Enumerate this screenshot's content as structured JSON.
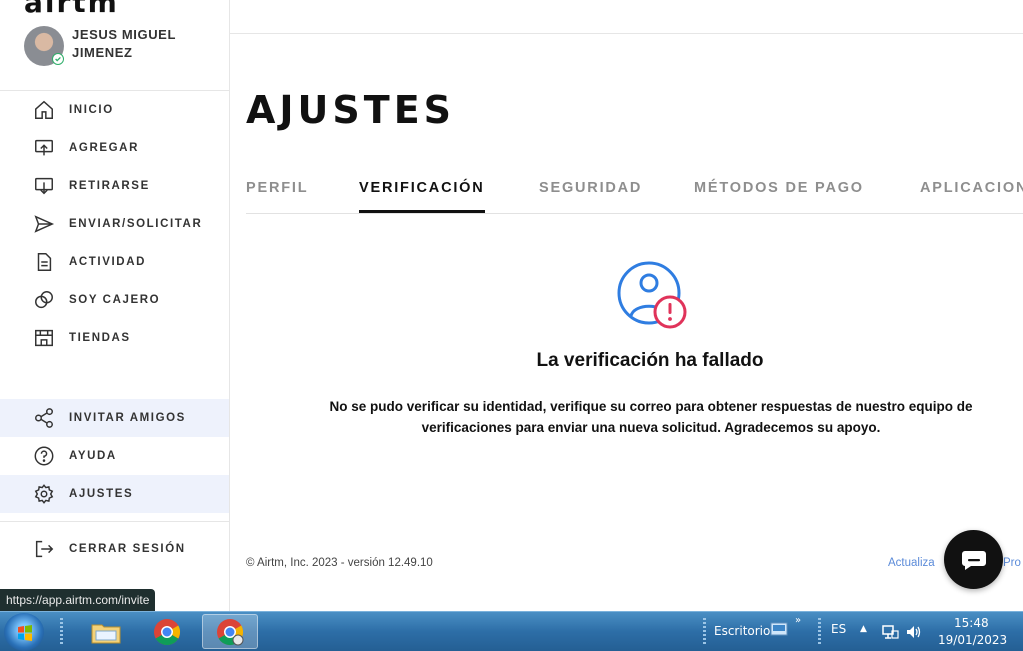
{
  "app": {
    "logo_text": "airtm"
  },
  "user": {
    "name": "JESUS MIGUEL JIMENEZ"
  },
  "sidebar": {
    "items": [
      {
        "label": "INICIO",
        "icon": "home-icon"
      },
      {
        "label": "AGREGAR",
        "icon": "add-funds-icon"
      },
      {
        "label": "RETIRARSE",
        "icon": "withdraw-icon"
      },
      {
        "label": "ENVIAR/SOLICITAR",
        "icon": "send-icon"
      },
      {
        "label": "ACTIVIDAD",
        "icon": "document-icon"
      },
      {
        "label": "SOY CAJERO",
        "icon": "exchange-icon"
      },
      {
        "label": "TIENDAS",
        "icon": "store-icon"
      }
    ],
    "secondary": [
      {
        "label": "INVITAR AMIGOS",
        "icon": "share-icon",
        "active": true
      },
      {
        "label": "AYUDA",
        "icon": "help-icon"
      },
      {
        "label": "AJUSTES",
        "icon": "gear-icon",
        "active": true
      }
    ],
    "logout": {
      "label": "CERRAR SESIÓN",
      "icon": "logout-icon"
    }
  },
  "main": {
    "title": "AJUSTES",
    "tabs": [
      {
        "label": "PERFIL"
      },
      {
        "label": "VERIFICACIÓN",
        "active": true
      },
      {
        "label": "SEGURIDAD"
      },
      {
        "label": "MÉTODOS DE PAGO"
      },
      {
        "label": "APLICACIONES"
      }
    ],
    "status": {
      "title": "La verificación ha fallado",
      "description": "No se pudo verificar su identidad, verifique su correo para obtener respuestas de nuestro equipo de verificaciones para enviar una nueva solicitud. Agradecemos su apoyo."
    },
    "footer": {
      "copyright": "© Airtm, Inc. 2023 - versión 12.49.10",
      "link1": "Actualiza",
      "link2": "Pro"
    }
  },
  "browser": {
    "status_url": "https://app.airtm.com/invite"
  },
  "taskbar": {
    "desktop_label": "Escritorio",
    "language": "ES",
    "time": "15:48",
    "date": "19/01/2023"
  },
  "colors": {
    "accent_blue": "#2f7de1",
    "error_red": "#e0335a",
    "active_bg": "#eef2fc",
    "verified_green": "#2fae6a"
  }
}
